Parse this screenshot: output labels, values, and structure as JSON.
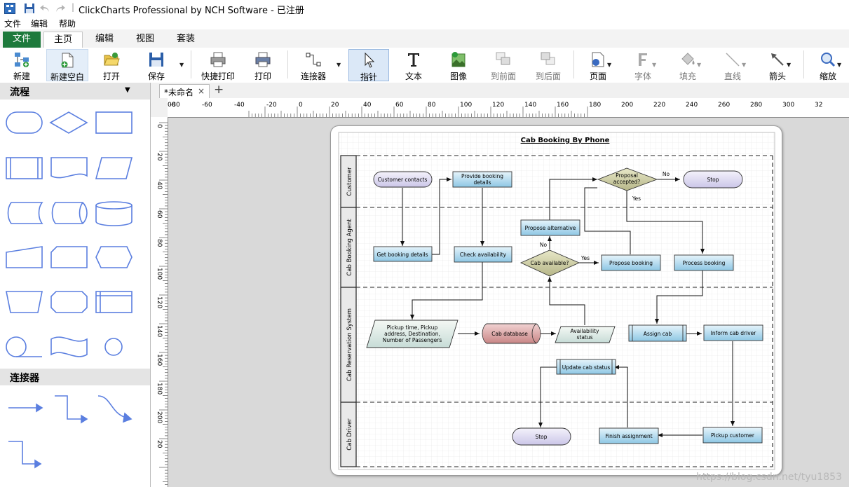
{
  "app": {
    "title": "ClickCharts Professional by NCH Software - 已注册"
  },
  "menu": [
    "文件",
    "编辑",
    "帮助"
  ],
  "ribbon_tabs": [
    "文件",
    "主页",
    "编辑",
    "视图",
    "套装"
  ],
  "toolbar": {
    "new": "新建",
    "new_blank": "新建空白",
    "open": "打开",
    "save": "保存",
    "quick_print": "快捷打印",
    "print": "打印",
    "connector": "连接器",
    "pointer": "指针",
    "text": "文本",
    "image": "图像",
    "to_front": "到前面",
    "to_back": "到后面",
    "page": "页面",
    "font": "字体",
    "fill": "填充",
    "line": "直线",
    "arrow": "箭头",
    "zoom": "缩放"
  },
  "panels": {
    "flow": "流程",
    "connectors": "连接器"
  },
  "document": {
    "tab_label": "*未命名",
    "close": "×",
    "add": "+"
  },
  "ruler": {
    "h": [
      "00",
      "-80",
      "-60",
      "-40",
      "-20",
      "0",
      "20",
      "40",
      "60",
      "80",
      "100",
      "120",
      "140",
      "160",
      "180",
      "200",
      "220",
      "240",
      "260",
      "280",
      "300",
      "32"
    ],
    "v": [
      "0",
      "20",
      "40",
      "60",
      "80",
      "100",
      "120",
      "140",
      "160",
      "180",
      "200",
      "20"
    ]
  },
  "diagram": {
    "title": "Cab Booking By Phone",
    "lanes": [
      "Customer",
      "Cab Booking Agent",
      "Cab Reservation System",
      "Cab Driver"
    ],
    "nodes": {
      "customer_contacts": "Customer contacts",
      "provide_booking": [
        "Provide booking",
        "details"
      ],
      "proposal_accepted": [
        "Proposal",
        "accepted?"
      ],
      "stop_top": "Stop",
      "no_label_top": "No",
      "yes_label_top": "Yes",
      "propose_alternative": "Propose alternative",
      "get_booking": "Get booking details",
      "check_availability": "Check availability",
      "cab_available": "Cab  available?",
      "no_label_mid": "No",
      "yes_label_mid": "Yes",
      "propose_booking": "Propose booking",
      "process_booking": "Process booking",
      "pickup_time": [
        "Pickup time,  Pickup",
        "address, Destination,",
        "Number of Passengers"
      ],
      "cab_database": "Cab database",
      "availability_status": [
        "Availability",
        "status"
      ],
      "assign_cab": "Assign cab",
      "inform_driver": "Inform cab driver",
      "update_status": "Update cab status",
      "stop_bottom": "Stop",
      "finish_assignment": "Finish assignment",
      "pickup_customer": "Pickup customer"
    }
  },
  "watermark": "https://blog.csdn.net/tyu1853",
  "colors": {
    "file_tab": "#1e7a3c",
    "shape_stroke": "#5b7fe0",
    "process_fill": "#9fcfe8",
    "decision_fill": "#c9c99a",
    "terminator_fill": "#d6d2ee",
    "database_fill": "#d79a9a"
  }
}
